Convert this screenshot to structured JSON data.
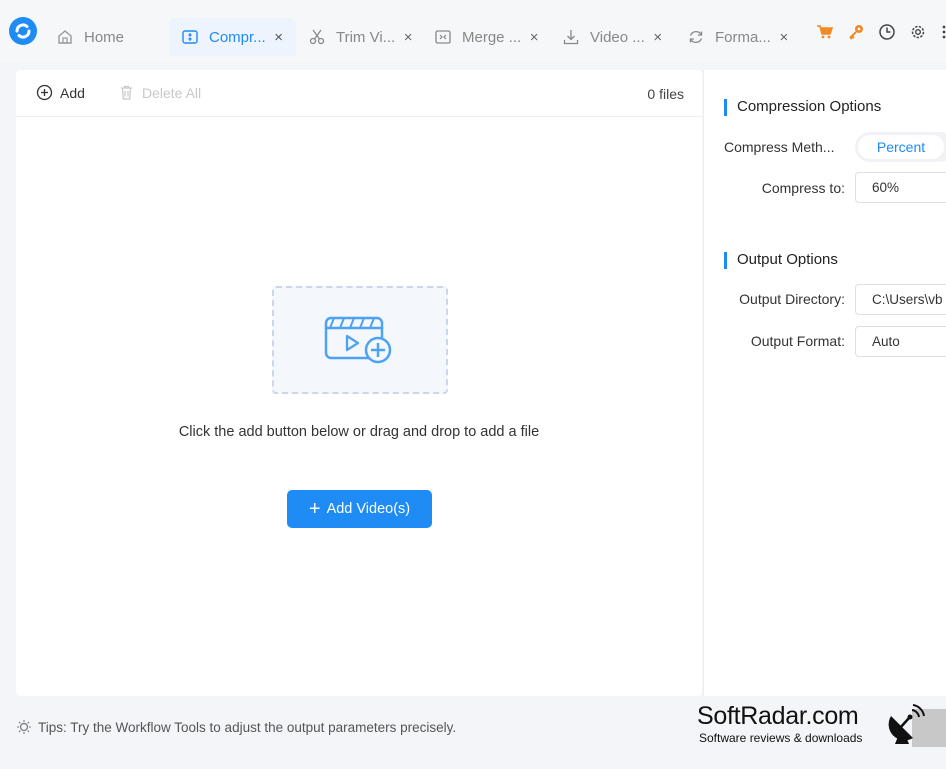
{
  "tabs": [
    {
      "label": "Home",
      "icon": "home-icon",
      "active": false
    },
    {
      "label": "Compr...",
      "icon": "compress-icon",
      "active": true
    },
    {
      "label": "Trim Vi...",
      "icon": "scissors-icon",
      "active": false
    },
    {
      "label": "Merge ...",
      "icon": "merge-icon",
      "active": false
    },
    {
      "label": "Video ...",
      "icon": "download-icon",
      "active": false
    },
    {
      "label": "Forma...",
      "icon": "convert-icon",
      "active": false
    }
  ],
  "tab_close_glyph": "×",
  "toolbar": {
    "add_label": "Add",
    "delete_all_label": "Delete All",
    "file_count": "0 files"
  },
  "dropzone": {
    "hint": "Click the add button below or drag and drop to add a file",
    "button_label": "Add Video(s)"
  },
  "compression": {
    "title": "Compression Options",
    "method_label": "Compress Meth...",
    "method_value": "Percent",
    "compress_to_label": "Compress to:",
    "compress_to_value": "60%"
  },
  "output": {
    "title": "Output Options",
    "directory_label": "Output Directory:",
    "directory_value": "C:\\Users\\vb",
    "format_label": "Output Format:",
    "format_value": "Auto"
  },
  "tips": "Tips: Try the Workflow Tools to adjust the output parameters precisely.",
  "watermark": {
    "main": "SoftRadar.com",
    "sub": "Software reviews & downloads"
  },
  "colors": {
    "accent": "#1f8bf5",
    "cart": "#f08a24",
    "key": "#f08a24"
  }
}
